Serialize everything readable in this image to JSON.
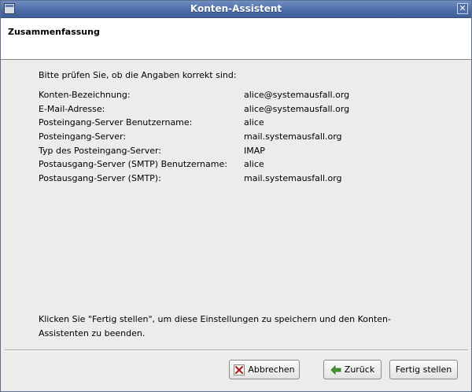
{
  "window": {
    "title": "Konten-Assistent"
  },
  "header": {
    "title": "Zusammenfassung"
  },
  "intro": "Bitte prüfen Sie, ob die Angaben korrekt sind:",
  "summary": [
    {
      "label": "Konten-Bezeichnung:",
      "value": "alice@systemausfall.org"
    },
    {
      "label": "E-Mail-Adresse:",
      "value": "alice@systemausfall.org"
    },
    {
      "label": "Posteingang-Server Benutzername:",
      "value": "alice"
    },
    {
      "label": "Posteingang-Server:",
      "value": "mail.systemausfall.org"
    },
    {
      "label": "Typ des Posteingang-Server:",
      "value": "IMAP"
    },
    {
      "label": "Postausgang-Server (SMTP) Benutzername:",
      "value": "alice"
    },
    {
      "label": "Postausgang-Server (SMTP):",
      "value": "mail.systemausfall.org"
    }
  ],
  "footer_text": "Klicken Sie \"Fertig stellen\", um diese Einstellungen zu speichern und den Konten-Assistenten zu beenden.",
  "buttons": {
    "cancel": "Abbrechen",
    "back": "Zurück",
    "finish": "Fertig stellen"
  },
  "icons": {
    "window": "window-icon",
    "close": "close-icon",
    "cancel": "x-icon",
    "back": "arrow-left-icon"
  },
  "colors": {
    "titlebar": "#4a6aa5",
    "cancel_icon": "#b11f1f",
    "back_icon": "#3e9a2a"
  }
}
